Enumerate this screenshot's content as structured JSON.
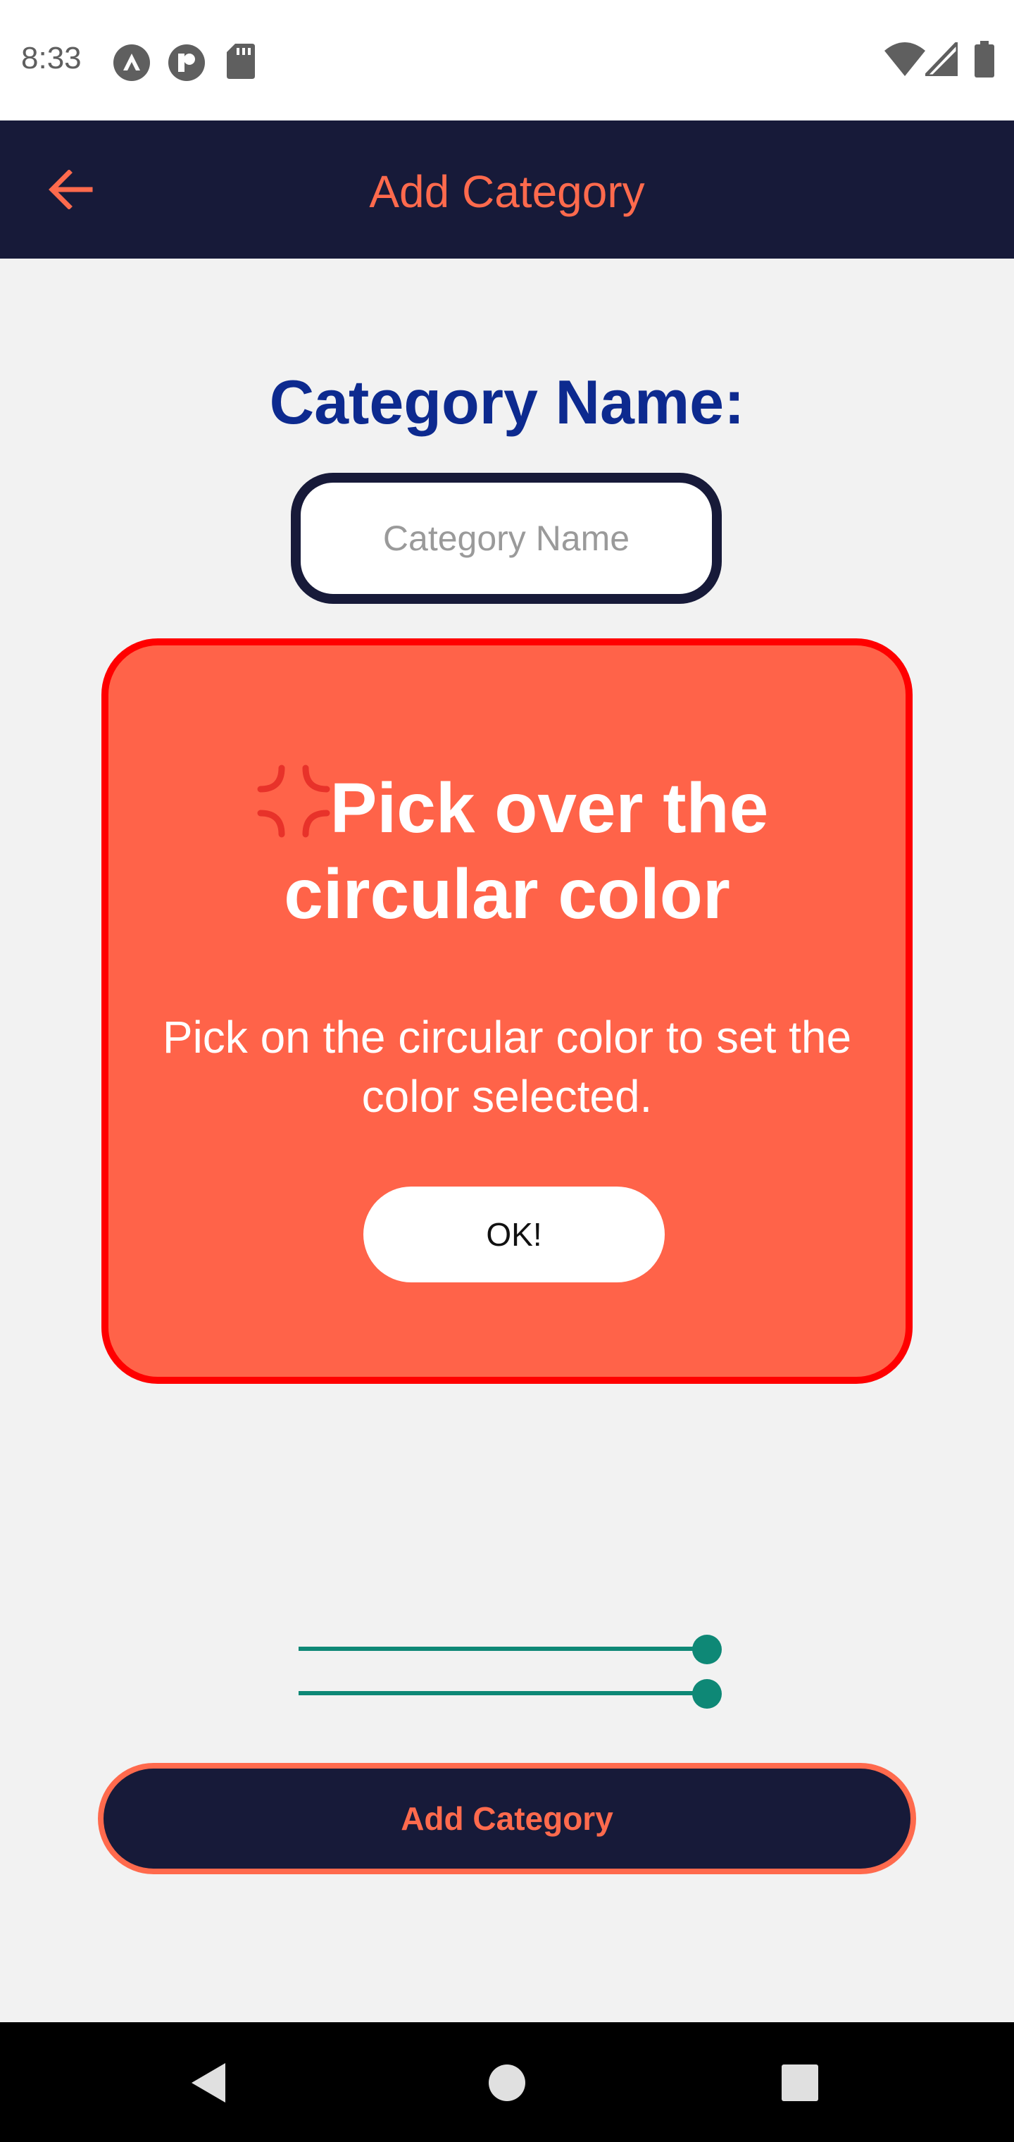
{
  "status_bar": {
    "time": "8:33",
    "left_icons": [
      "assistant-icon",
      "app-notification-icon",
      "sd-card-icon"
    ],
    "right_icons": [
      "wifi-icon",
      "signal-icon",
      "battery-icon"
    ]
  },
  "app_bar": {
    "back_icon": "arrow-left-icon",
    "title": "Add Category"
  },
  "form": {
    "label": "Category Name:",
    "input_value": "",
    "input_placeholder": "Category Name"
  },
  "dialog": {
    "icon": "anger-symbol-icon",
    "title": "Pick over the circular color",
    "message": "Pick on the circular color to set the color selected.",
    "ok_label": "OK!"
  },
  "sliders": [
    {
      "name": "slider-1",
      "value": 1.0
    },
    {
      "name": "slider-2",
      "value": 1.0
    }
  ],
  "submit_button_label": "Add Category",
  "nav_bar": {
    "buttons": [
      "back-triangle-icon",
      "home-circle-icon",
      "recents-square-icon"
    ]
  },
  "colors": {
    "app_bar_bg": "#171a39",
    "accent": "#ff6a4d",
    "label_blue": "#0d2a8f",
    "dialog_bg": "#ff6349",
    "dialog_border": "#ff0000",
    "slider": "#0e8876",
    "background": "#f2f2f2"
  }
}
